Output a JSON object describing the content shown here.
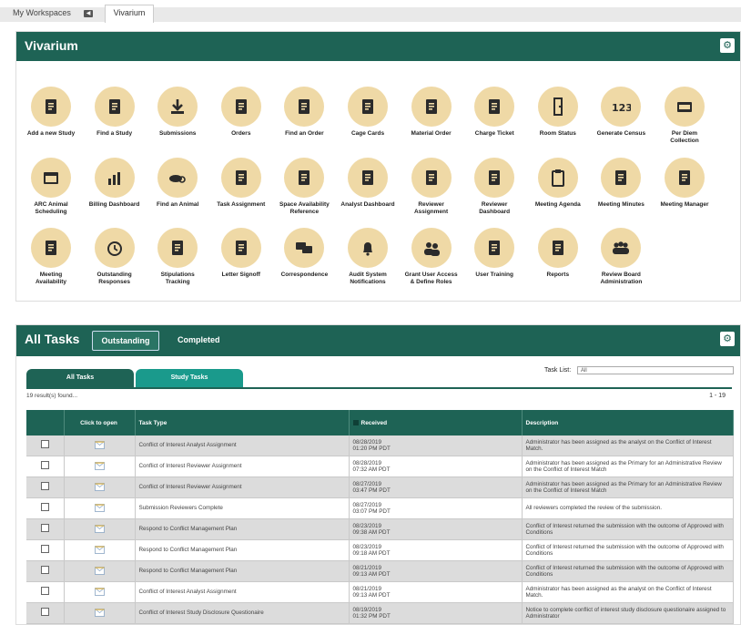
{
  "top_tabs": {
    "workspaces": "My Workspaces",
    "vivarium": "Vivarium"
  },
  "vivarium_panel": {
    "title": "Vivarium",
    "items": [
      {
        "label": "Add a new Study",
        "icon": "add-study-icon"
      },
      {
        "label": "Find a Study",
        "icon": "find-study-icon"
      },
      {
        "label": "Submissions",
        "icon": "download-icon"
      },
      {
        "label": "Orders",
        "icon": "orders-icon"
      },
      {
        "label": "Find an Order",
        "icon": "find-order-icon"
      },
      {
        "label": "Cage Cards",
        "icon": "cage-cards-icon"
      },
      {
        "label": "Material Order",
        "icon": "material-order-icon"
      },
      {
        "label": "Charge Ticket",
        "icon": "charge-ticket-icon"
      },
      {
        "label": "Room Status",
        "icon": "door-icon"
      },
      {
        "label": "Generate Census",
        "icon": "census-123-icon"
      },
      {
        "label": "Per Diem Collection",
        "icon": "per-diem-icon"
      },
      {
        "label": "ARC Animal Scheduling",
        "icon": "calendar-icon"
      },
      {
        "label": "Billing Dashboard",
        "icon": "chart-icon"
      },
      {
        "label": "Find an Animal",
        "icon": "find-animal-icon"
      },
      {
        "label": "Task Assignment",
        "icon": "task-assignment-icon"
      },
      {
        "label": "Space Availability Reference",
        "icon": "space-availability-icon"
      },
      {
        "label": "Analyst Dashboard",
        "icon": "analyst-dashboard-icon"
      },
      {
        "label": "Reviewer Assignment",
        "icon": "reviewer-assignment-icon"
      },
      {
        "label": "Reviewer Dashboard",
        "icon": "reviewer-dashboard-icon"
      },
      {
        "label": "Meeting Agenda",
        "icon": "clipboard-icon"
      },
      {
        "label": "Meeting Minutes",
        "icon": "meeting-minutes-icon"
      },
      {
        "label": "Meeting Manager",
        "icon": "meeting-manager-icon"
      },
      {
        "label": "Meeting Availability",
        "icon": "meeting-availability-icon"
      },
      {
        "label": "Outstanding Responses",
        "icon": "clock-icon"
      },
      {
        "label": "Stipulations Tracking",
        "icon": "stipulations-icon"
      },
      {
        "label": "Letter Signoff",
        "icon": "letter-signoff-icon"
      },
      {
        "label": "Correspondence",
        "icon": "chat-icon"
      },
      {
        "label": "Audit System Notifications",
        "icon": "bell-icon"
      },
      {
        "label": "Grant User Access & Define Roles",
        "icon": "users-icon"
      },
      {
        "label": "User Training",
        "icon": "training-icon"
      },
      {
        "label": "Reports",
        "icon": "reports-icon"
      },
      {
        "label": "Review Board Administration",
        "icon": "review-board-icon"
      }
    ]
  },
  "tasks_panel": {
    "title": "All Tasks",
    "tab_outstanding": "Outstanding",
    "tab_completed": "Completed",
    "subtab_all": "All Tasks",
    "subtab_study": "Study Tasks",
    "task_list_label": "Task List:",
    "task_list_value": "All",
    "results_text": "19 result(s) found...",
    "range_text": "1 - 19",
    "columns": [
      "",
      "Click to open",
      "Task Type",
      "Received",
      "Description"
    ],
    "rows": [
      {
        "type": "Conflict of Interest Analyst Assignment",
        "date": "08/28/2019",
        "time": "01:20 PM PDT",
        "desc": "Administrator has been assigned as the analyst on the Conflict of Interest Match."
      },
      {
        "type": "Conflict of Interest Reviewer Assignment",
        "date": "08/28/2019",
        "time": "07:32 AM PDT",
        "desc": "Administrator has been assigned as the Primary for an Administrative Review on the Conflict of Interest Match"
      },
      {
        "type": "Conflict of Interest Reviewer Assignment",
        "date": "08/27/2019",
        "time": "03:47 PM PDT",
        "desc": "Administrator has been assigned as the Primary for an Administrative Review on the Conflict of Interest Match"
      },
      {
        "type": "Submission Reviewers Complete",
        "date": "08/27/2019",
        "time": "03:07 PM PDT",
        "desc": "All reviewers completed the review of the submission."
      },
      {
        "type": "Respond to Conflict Management Plan",
        "date": "08/23/2019",
        "time": "09:38 AM PDT",
        "desc": "Conflict of Interest returned the submission with the outcome of Approved with Conditions"
      },
      {
        "type": "Respond to Conflict Management Plan",
        "date": "08/23/2019",
        "time": "09:18 AM PDT",
        "desc": "Conflict of Interest returned the submission with the outcome of Approved with Conditions"
      },
      {
        "type": "Respond to Conflict Management Plan",
        "date": "08/21/2019",
        "time": "09:13 AM PDT",
        "desc": "Conflict of Interest returned the submission with the outcome of Approved with Conditions"
      },
      {
        "type": "Conflict of Interest Analyst Assignment",
        "date": "08/21/2019",
        "time": "09:13 AM PDT",
        "desc": "Administrator has been assigned as the analyst on the Conflict of Interest Match."
      },
      {
        "type": "Conflict of Interest Study Disclosure Questionaire",
        "date": "08/19/2019",
        "time": "01:32 PM PDT",
        "desc": "Notice to complete conflict of interest study disclosure questionaire assigned to Administrator"
      }
    ]
  },
  "colors": {
    "header_green": "#1e6355",
    "subtab_teal": "#1a9a8c",
    "icon_circle": "#efd9a6"
  }
}
